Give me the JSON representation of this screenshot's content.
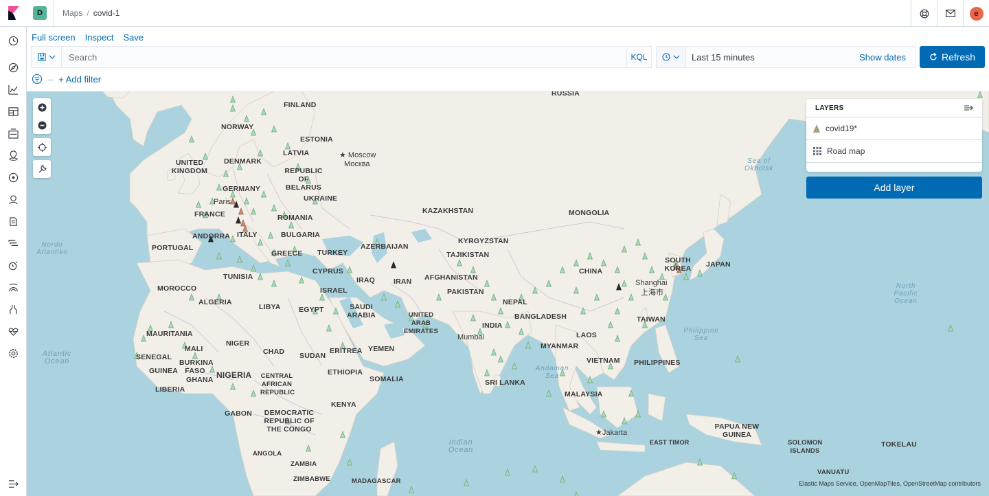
{
  "header": {
    "space_initial": "D",
    "breadcrumbs": {
      "parent": "Maps",
      "separator": "/",
      "current": "covid-1"
    },
    "user_initial": "e"
  },
  "app_menu": {
    "full_screen": "Full screen",
    "inspect": "Inspect",
    "save": "Save"
  },
  "query": {
    "placeholder": "Search",
    "language": "KQL"
  },
  "time": {
    "range": "Last 15 minutes",
    "show_dates": "Show dates",
    "refresh": "Refresh"
  },
  "filters": {
    "add_filter": "+ Add filter"
  },
  "map": {
    "countries": [
      "RUSSIA",
      "FINLAND",
      "NORWAY",
      "ESTONIA",
      "LATVIA",
      "DENMARK",
      "UNITED KINGDOM",
      "REPUBLIC OF BELARUS",
      "GERMANY",
      "UKRAINE",
      "FRANCE",
      "ROMANIA",
      "ANDORRA",
      "ITALY",
      "BULGARIA",
      "PORTUGAL",
      "GREECE",
      "TURKEY",
      "KAZAKHSTAN",
      "MONGOLIA",
      "KYRGYZSTAN",
      "AZERBAIJAN",
      "TAJIKISTAN",
      "SOUTH KOREA",
      "JAPAN",
      "CYPRUS",
      "TUNISIA",
      "IRAQ",
      "IRAN",
      "AFGHANISTAN",
      "CHINA",
      "MOROCCO",
      "ALGERIA",
      "LIBYA",
      "ISRAEL",
      "PAKISTAN",
      "NEPAL",
      "EGYPT",
      "SAUDI ARABIA",
      "UNITED ARAB EMIRATES",
      "INDIA",
      "BANGLADESH",
      "TAIWAN",
      "MAURITANIA",
      "MALI",
      "NIGER",
      "CHAD",
      "SUDAN",
      "ERITREA",
      "YEMEN",
      "MYANMAR",
      "LAOS",
      "SENEGAL",
      "BURKINA FASO",
      "GUINEA",
      "GHANA",
      "NIGERIA",
      "ETHIOPIA",
      "SOMALIA",
      "VIETNAM",
      "PHILIPPINES",
      "LIBERIA",
      "CENTRAL AFRICAN REPUBLIC",
      "SRI LANKA",
      "MALAYSIA",
      "GABON",
      "DEMOCRATIC REPUBLIC OF THE CONGO",
      "KENYA",
      "PAPUA NEW GUINEA",
      "EAST TIMOR",
      "SOLOMON ISLANDS",
      "TOKELAU",
      "ANGOLA",
      "ZAMBIA",
      "ZIMBABWE",
      "MADAGASCAR",
      "VANUATU"
    ],
    "cities": [
      "Moscow",
      "Москва",
      "Paris",
      "Shanghai",
      "上海市",
      "Mumbai",
      "Jakarta"
    ],
    "seas": [
      "Sea of Okhotsk",
      "Nordo Atlantiko",
      "Atlantic Ocean",
      "North Pacific Ocean",
      "Philippine Sea",
      "Andaman Sea",
      "Indian Ocean"
    ],
    "attribution": "Elastic Maps Service, OpenMapTiles, OpenStreetMap contributors"
  },
  "layers": {
    "title": "LAYERS",
    "items": [
      {
        "name": "covid19*",
        "icon": "marker-icon"
      },
      {
        "name": "Road map",
        "icon": "grid-icon"
      }
    ],
    "add_layer": "Add layer"
  },
  "colors": {
    "accent": "#006bb4",
    "land": "#f1efe8",
    "water": "#aad3df",
    "marker": "#7fb98f"
  }
}
